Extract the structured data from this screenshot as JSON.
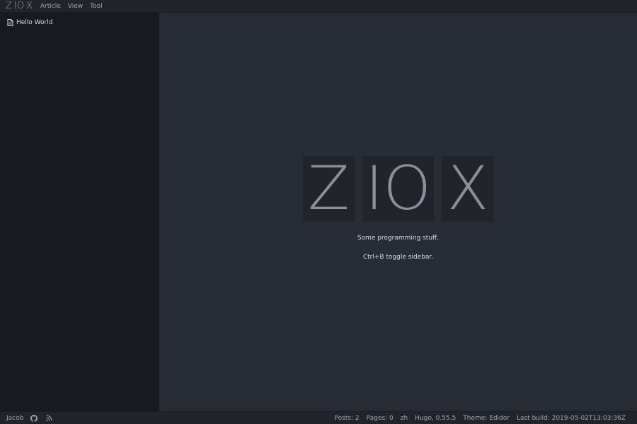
{
  "app": {
    "logo_letters": [
      "Z",
      "IO",
      "X"
    ]
  },
  "menubar": {
    "items": [
      {
        "label": "Article"
      },
      {
        "label": "View"
      },
      {
        "label": "Tool"
      }
    ]
  },
  "sidebar": {
    "items": [
      {
        "label": "Hello World",
        "icon": "file-icon"
      }
    ]
  },
  "main": {
    "brand_letters": [
      "Z",
      "IO",
      "X"
    ],
    "tagline": "Some programming stuff.",
    "hint": "Ctrl+B toggle sidebar."
  },
  "statusbar": {
    "author": "Jacob",
    "icons": [
      "github-icon",
      "rss-icon"
    ],
    "posts": "Posts: 2",
    "pages": "Pages: 0",
    "lang": "zh",
    "hugo": "Hugo, 0.55.5",
    "theme": "Theme: Edidor",
    "last_build": "Last build: 2019-05-02T13:03:36Z"
  },
  "colors": {
    "background": "#282c34",
    "sidebar": "#181a1f",
    "bars": "#21252b",
    "tile": "#21252b",
    "logo_text": "#8a8f99",
    "text": "#d7dae0"
  }
}
